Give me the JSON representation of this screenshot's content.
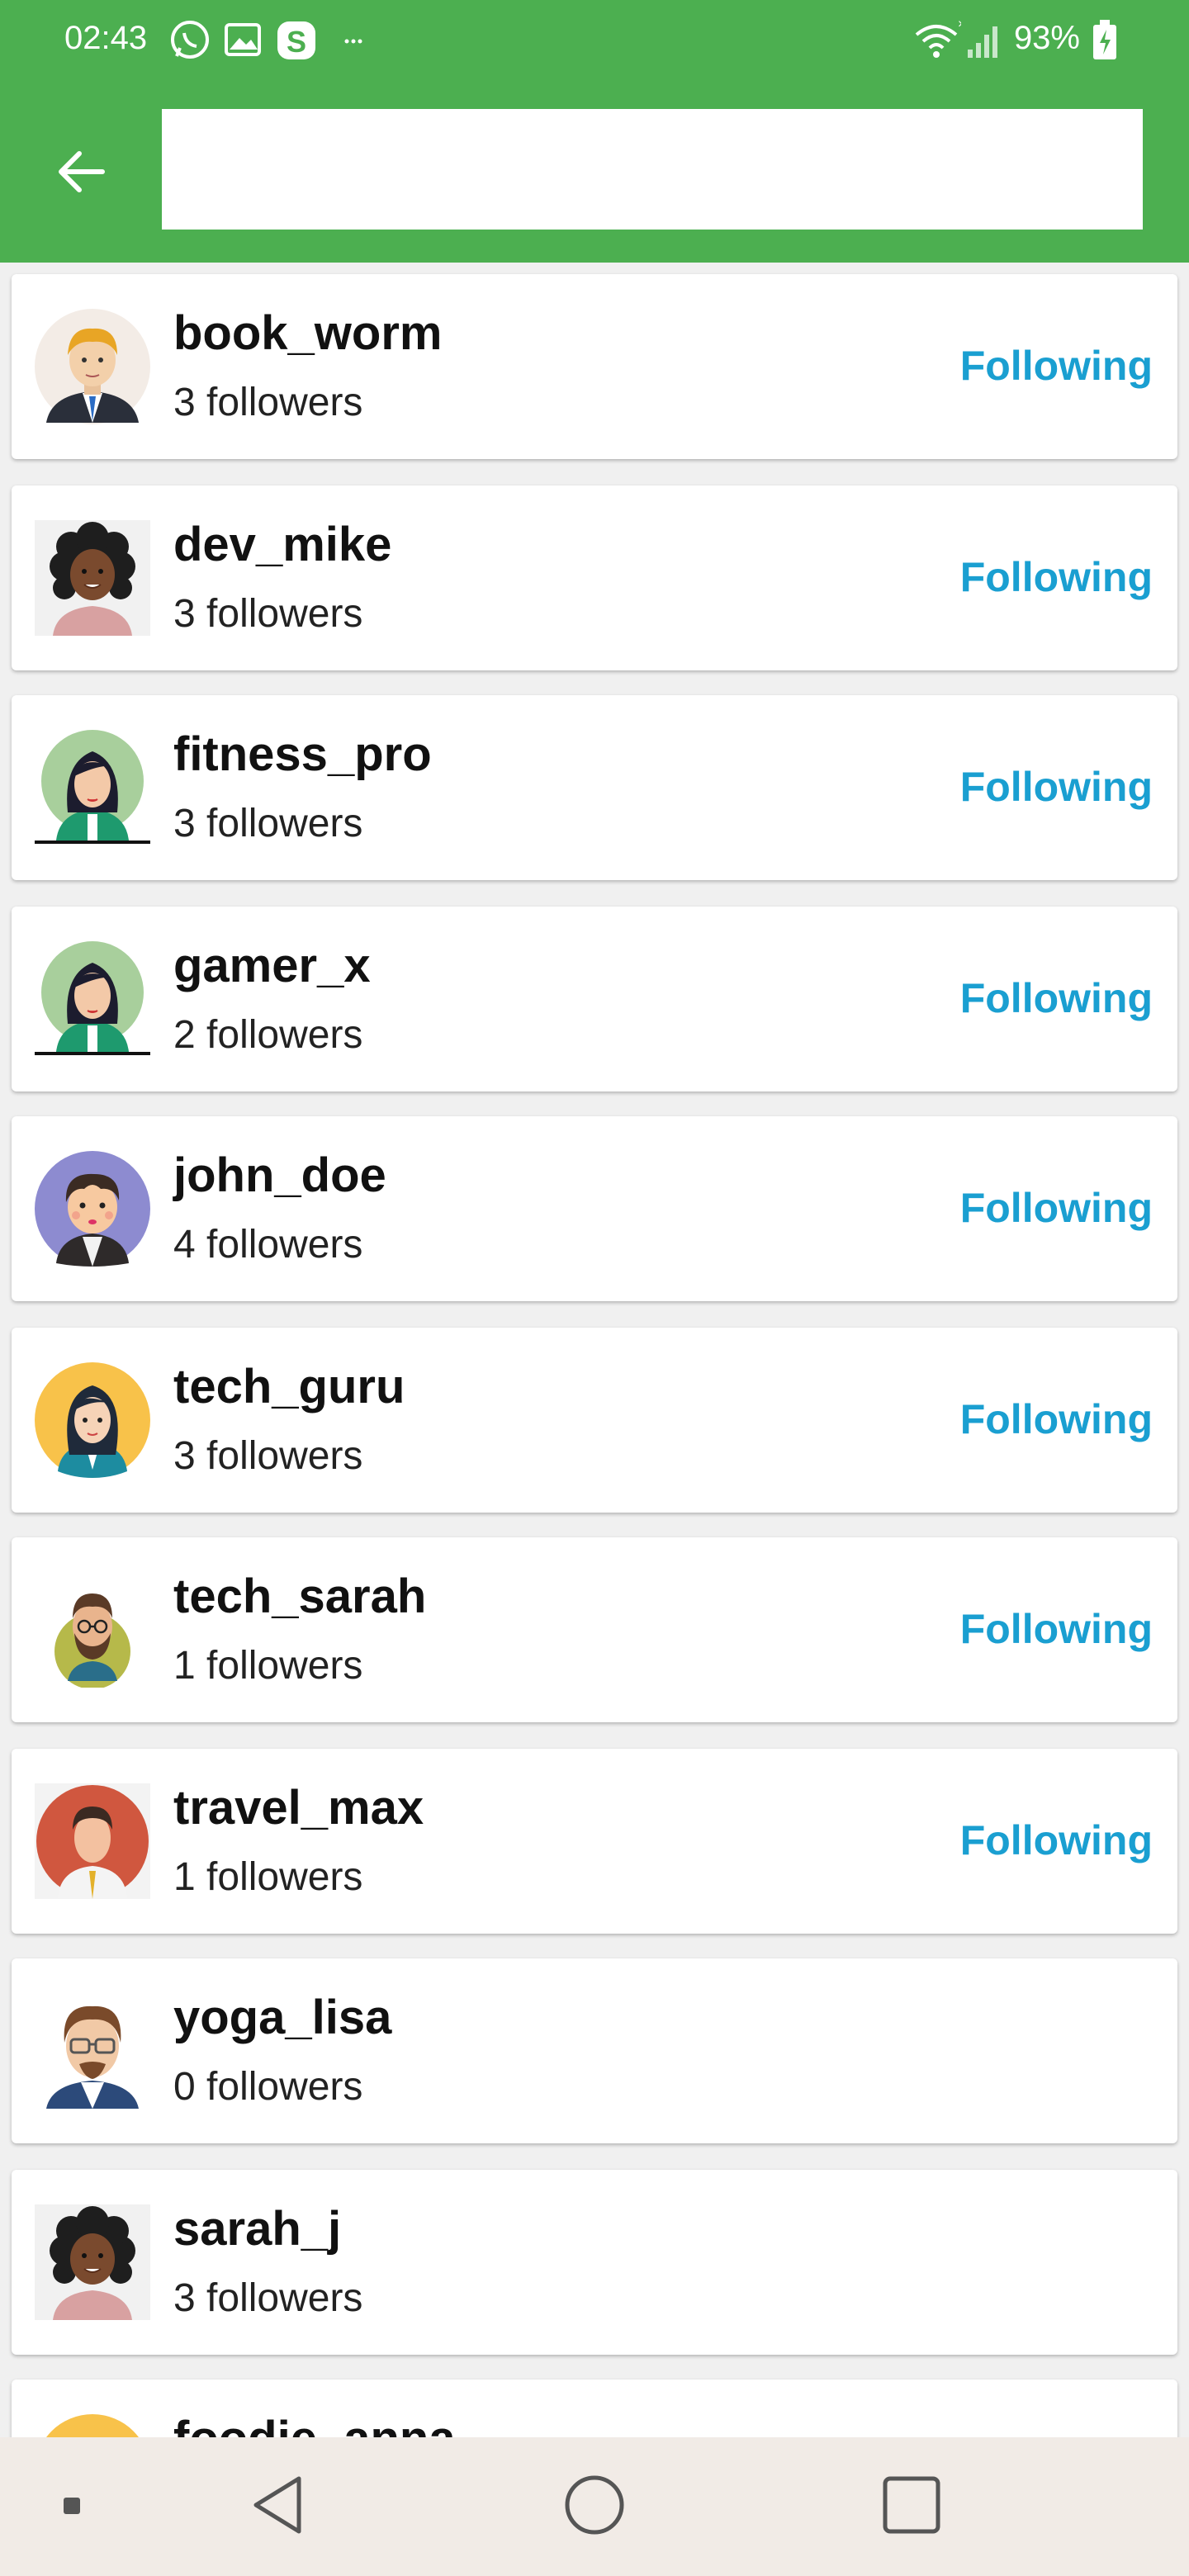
{
  "status_bar": {
    "time": "02:43",
    "battery": "93%",
    "icons": [
      "whatsapp-icon",
      "gallery-icon",
      "s-app-icon",
      "more-dots-icon",
      "wifi-icon",
      "signal-icon",
      "battery-charging-icon"
    ]
  },
  "header": {
    "back_icon": "arrow-left-icon",
    "search_value": "",
    "accent_color": "#4caf50"
  },
  "users": [
    {
      "name": "book_worm",
      "followers": "3 followers",
      "action": "Following",
      "avatar": "man-suit-avatar"
    },
    {
      "name": "dev_mike",
      "followers": "3 followers",
      "action": "Following",
      "avatar": "woman-curly-avatar"
    },
    {
      "name": "fitness_pro",
      "followers": "3 followers",
      "action": "Following",
      "avatar": "woman-green-avatar"
    },
    {
      "name": "gamer_x",
      "followers": "2 followers",
      "action": "Following",
      "avatar": "woman-green-avatar"
    },
    {
      "name": "john_doe",
      "followers": "4 followers",
      "action": "Following",
      "avatar": "man-purple-avatar"
    },
    {
      "name": "tech_guru",
      "followers": "3 followers",
      "action": "Following",
      "avatar": "woman-yellow-avatar"
    },
    {
      "name": "tech_sarah",
      "followers": "1 followers",
      "action": "Following",
      "avatar": "man-beard-avatar"
    },
    {
      "name": "travel_max",
      "followers": "1 followers",
      "action": "Following",
      "avatar": "man-red-avatar"
    },
    {
      "name": "yoga_lisa",
      "followers": "0 followers",
      "action": "",
      "avatar": "man-glasses-avatar"
    },
    {
      "name": "sarah_j",
      "followers": "3 followers",
      "action": "",
      "avatar": "woman-curly-avatar"
    },
    {
      "name": "foodie_anna",
      "followers": "",
      "action": "",
      "avatar": "woman-yellow-avatar"
    }
  ],
  "nav_bar": {
    "icons": [
      "menu-dot-icon",
      "back-triangle-icon",
      "home-circle-icon",
      "recents-square-icon"
    ]
  },
  "colors": {
    "following_text": "#1a9fd1",
    "nav_background": "#f1ebe6"
  }
}
